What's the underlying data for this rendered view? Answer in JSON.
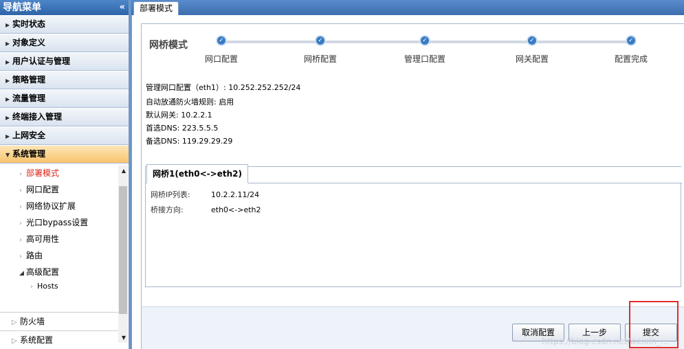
{
  "nav": {
    "title": "导航菜单",
    "collapse_glyph": "«",
    "sections": [
      {
        "label": "实时状态",
        "arrow": "▶"
      },
      {
        "label": "对象定义",
        "arrow": "▶"
      },
      {
        "label": "用户认证与管理",
        "arrow": "▶"
      },
      {
        "label": "策略管理",
        "arrow": "▶"
      },
      {
        "label": "流量管理",
        "arrow": "▶"
      },
      {
        "label": "终端接入管理",
        "arrow": "▶"
      },
      {
        "label": "上网安全",
        "arrow": "▶"
      }
    ],
    "active_section": {
      "label": "系统管理",
      "arrow": "▼"
    },
    "sub_items": [
      {
        "label": "部署模式"
      },
      {
        "label": "网口配置"
      },
      {
        "label": "网络协议扩展"
      },
      {
        "label": "光口bypass设置"
      },
      {
        "label": "高可用性"
      },
      {
        "label": "路由"
      },
      {
        "label": "高级配置"
      }
    ],
    "sub_sub_items": [
      {
        "label": "Hosts"
      }
    ],
    "bottom_sections": [
      {
        "label": "防火墙"
      },
      {
        "label": "系统配置"
      }
    ]
  },
  "tabs": {
    "active": "部署模式"
  },
  "wizard": {
    "title": "网桥模式",
    "steps": [
      {
        "label": "网口配置"
      },
      {
        "label": "网桥配置"
      },
      {
        "label": "管理口配置"
      },
      {
        "label": "网关配置"
      },
      {
        "label": "配置完成"
      }
    ]
  },
  "summary": {
    "mgmt_port": "管理网口配置（eth1）: 10.252.252.252/24",
    "firewall_rule": "自动放通防火墙规则: 启用",
    "gateway": "默认网关: 10.2.2.1",
    "dns1": "首选DNS: 223.5.5.5",
    "dns2": "备选DNS: 119.29.29.29"
  },
  "bridge": {
    "tab_label": "网桥1(eth0<->eth2)",
    "ip_key": "网桥IP列表:",
    "ip_value": "10.2.2.11/24",
    "dir_key": "桥接方向:",
    "dir_value": "eth0<->eth2"
  },
  "buttons": {
    "cancel": "取消配置",
    "prev": "上一步",
    "submit": "提交"
  },
  "watermark": "https://blog.csdn.net/weixin_..."
}
